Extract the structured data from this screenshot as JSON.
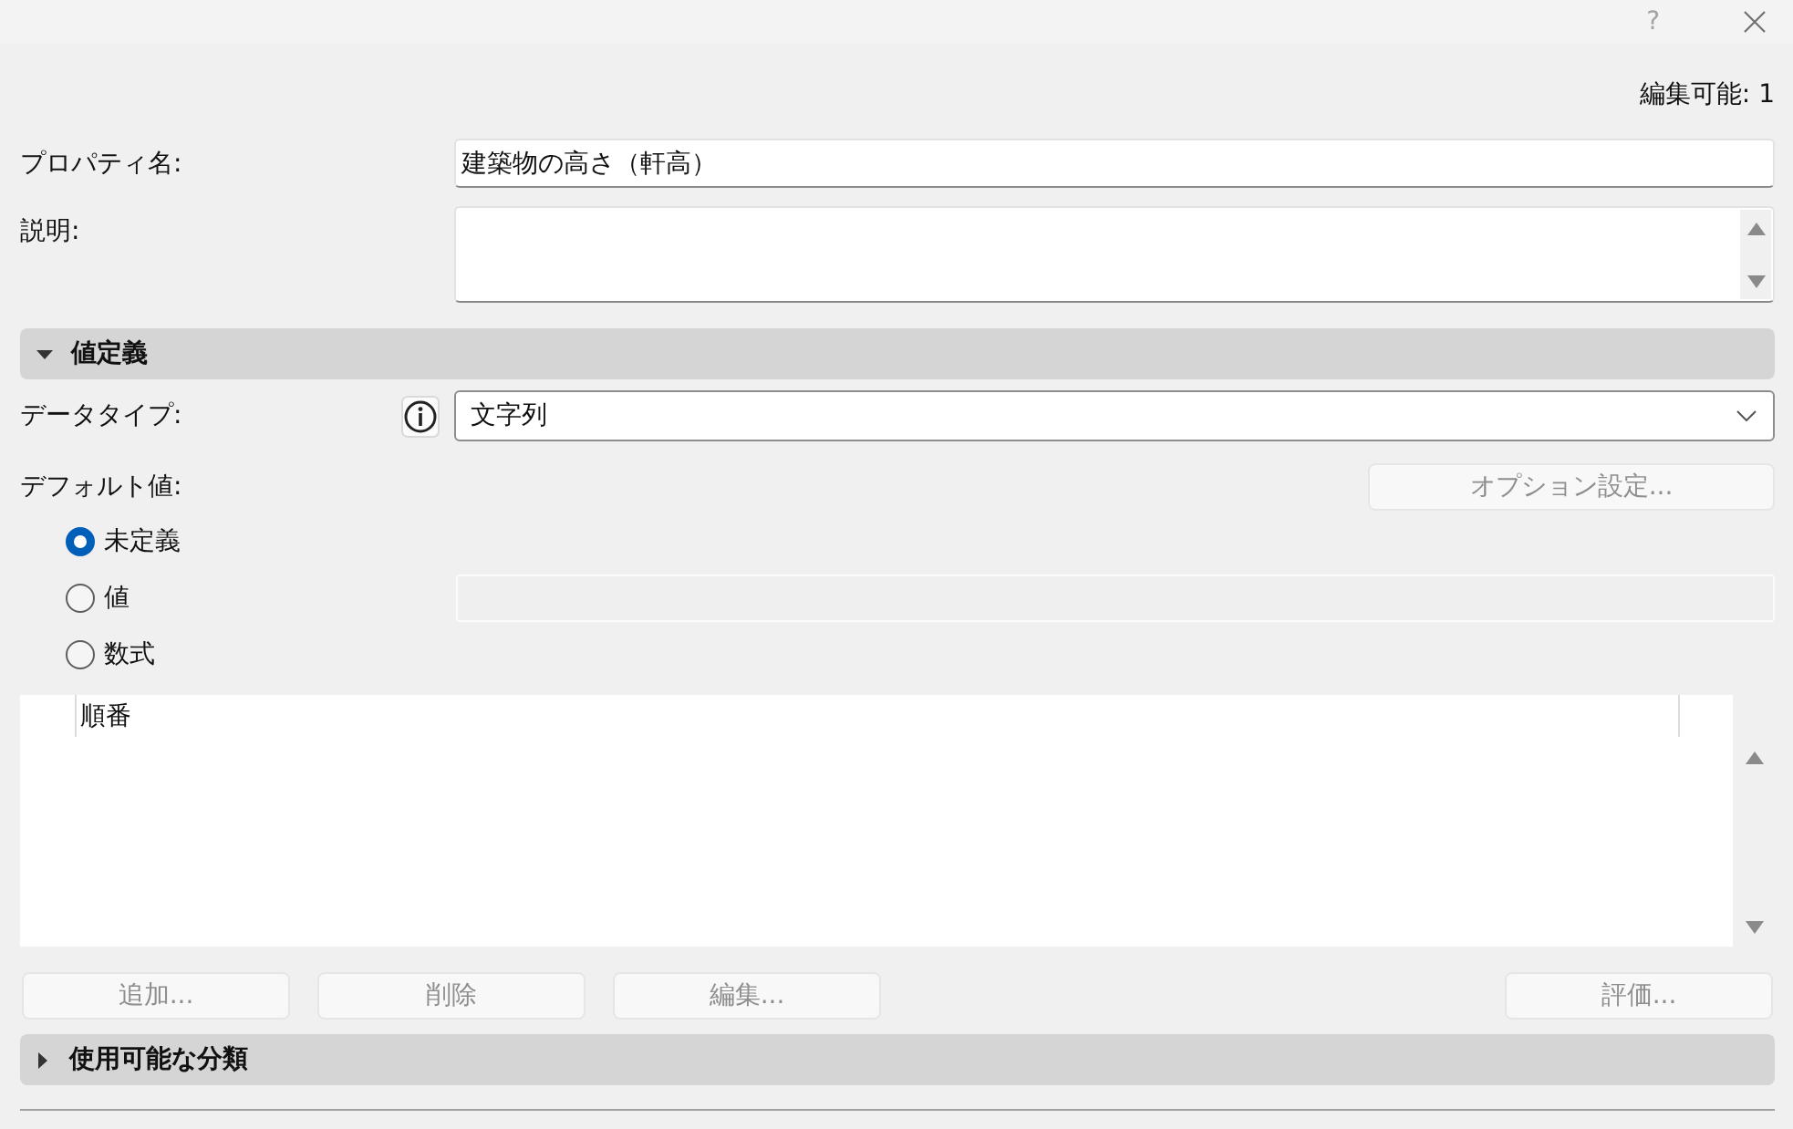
{
  "title_bar": {
    "help": "?"
  },
  "editable_status": "編集可能: 1",
  "property_name": {
    "label": "プロパティ名:",
    "value": "建築物の高さ（軒高）"
  },
  "description": {
    "label": "説明:"
  },
  "sections": [
    {
      "title": "値定義",
      "expanded": true,
      "data_type": {
        "label": "データタイプ:",
        "value": "文字列"
      },
      "default_value": {
        "label": "デフォルト値:",
        "options_button": {
          "label": "オプション設定...",
          "disabled": true
        },
        "choices": [
          {
            "label": "未定義",
            "selected": true
          },
          {
            "label": "値",
            "selected": false,
            "field": {
              "disabled": true
            }
          },
          {
            "label": "数式",
            "selected": false
          }
        ]
      },
      "list": {
        "columns": [
          "順番"
        ]
      },
      "buttons": [
        {
          "label": "追加...",
          "disabled": true
        },
        {
          "label": "削除",
          "disabled": true
        },
        {
          "label": "編集...",
          "disabled": true
        },
        {
          "label": "評価...",
          "disabled": true
        }
      ]
    },
    {
      "title": "使用可能な分類",
      "expanded": false
    }
  ]
}
